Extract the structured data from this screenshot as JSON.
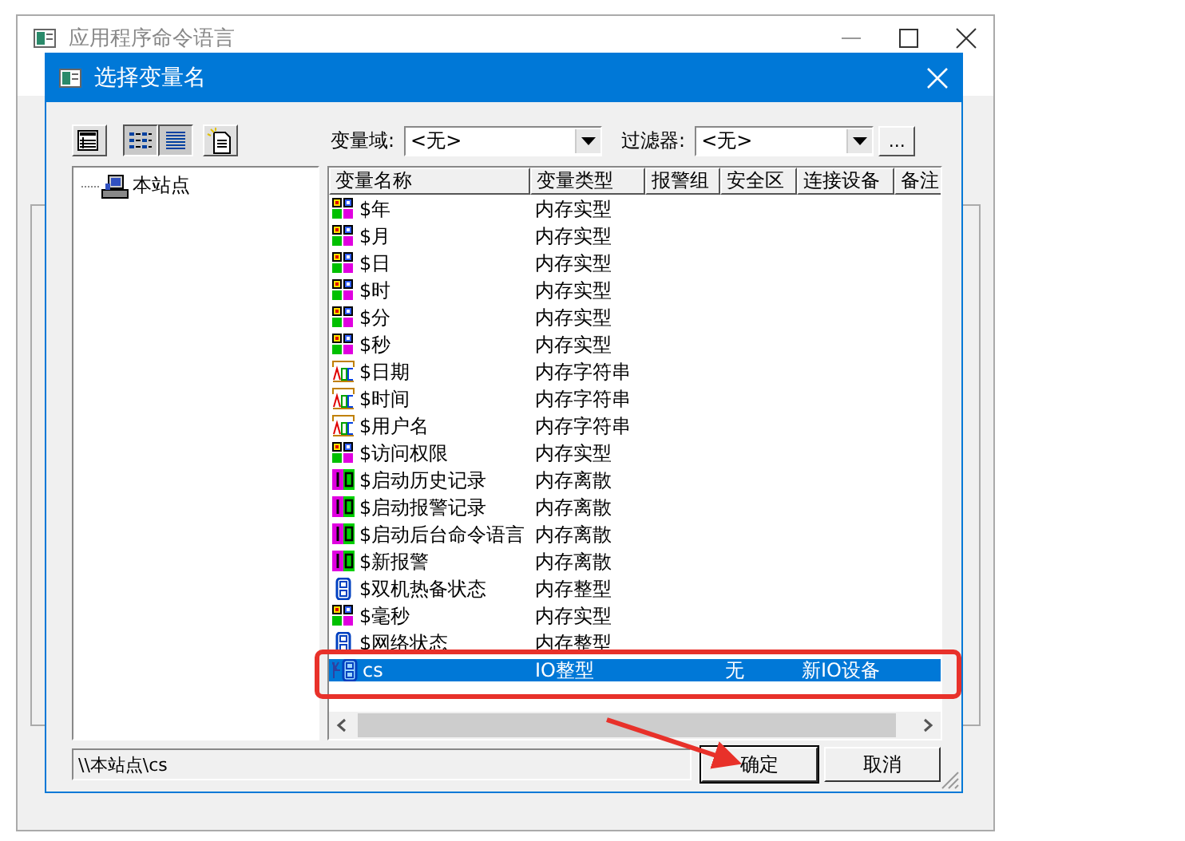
{
  "back_window": {
    "title": "应用程序命令语言"
  },
  "dialog": {
    "title": "选择变量名",
    "toolbar": [
      {
        "kind": "tree",
        "selected": false
      },
      {
        "kind": "list",
        "selected": true
      },
      {
        "kind": "details",
        "selected": true
      },
      {
        "kind": "new",
        "selected": false
      }
    ],
    "scope": {
      "label": "变量域:",
      "value": "<无>"
    },
    "filter": {
      "label": "过滤器:",
      "value": "<无>",
      "more": "..."
    },
    "tree": [
      {
        "label": "本站点"
      }
    ],
    "table": {
      "columns": [
        "变量名称",
        "变量类型",
        "报警组",
        "安全区",
        "连接设备",
        "备注"
      ],
      "rows": [
        {
          "kind": "real",
          "name": "$年",
          "type": "内存实型",
          "selected": false
        },
        {
          "kind": "real",
          "name": "$月",
          "type": "内存实型",
          "selected": false
        },
        {
          "kind": "real",
          "name": "$日",
          "type": "内存实型",
          "selected": false
        },
        {
          "kind": "real",
          "name": "$时",
          "type": "内存实型",
          "selected": false
        },
        {
          "kind": "real",
          "name": "$分",
          "type": "内存实型",
          "selected": false
        },
        {
          "kind": "real",
          "name": "$秒",
          "type": "内存实型",
          "selected": false
        },
        {
          "kind": "string",
          "name": "$日期",
          "type": "内存字符串",
          "selected": false
        },
        {
          "kind": "string",
          "name": "$时间",
          "type": "内存字符串",
          "selected": false
        },
        {
          "kind": "string",
          "name": "$用户名",
          "type": "内存字符串",
          "selected": false
        },
        {
          "kind": "real",
          "name": "$访问权限",
          "type": "内存实型",
          "selected": false
        },
        {
          "kind": "discrete",
          "name": "$启动历史记录",
          "type": "内存离散",
          "selected": false
        },
        {
          "kind": "discrete",
          "name": "$启动报警记录",
          "type": "内存离散",
          "selected": false
        },
        {
          "kind": "discrete",
          "name": "$启动后台命令语言",
          "type": "内存离散",
          "selected": false
        },
        {
          "kind": "discrete",
          "name": "$新报警",
          "type": "内存离散",
          "selected": false
        },
        {
          "kind": "int",
          "name": "$双机热备状态",
          "type": "内存整型",
          "selected": false
        },
        {
          "kind": "real",
          "name": "$毫秒",
          "type": "内存实型",
          "selected": false
        },
        {
          "kind": "int",
          "name": "$网络状态",
          "type": "内存整型",
          "selected": false
        },
        {
          "kind": "io_int",
          "name": "cs",
          "type": "IO整型",
          "security": "无",
          "device": "新IO设备",
          "selected": true
        }
      ]
    },
    "path": "\\\\本站点\\cs",
    "buttons": [
      "确定",
      "取消"
    ]
  }
}
